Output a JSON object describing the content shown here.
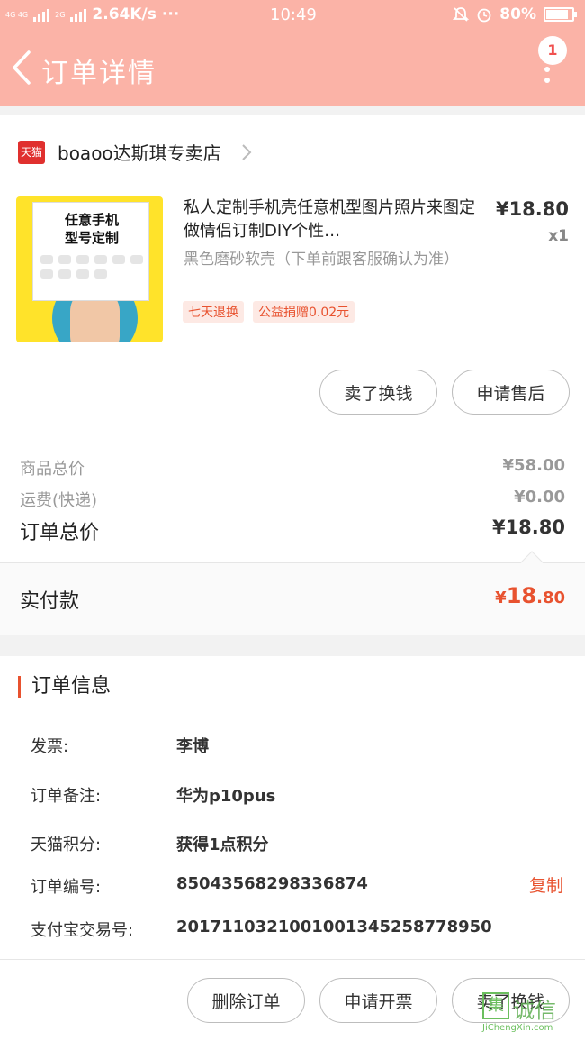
{
  "status_bar": {
    "network_top": "4G 4G",
    "network_bottom": "2G",
    "speed": "2.64K/s",
    "dots": "···",
    "time": "10:49",
    "battery": "80%"
  },
  "header": {
    "title": "订单详情",
    "badge_count": "1"
  },
  "shop": {
    "logo_text": "天猫",
    "name": "boaoo达斯琪专卖店"
  },
  "product": {
    "image_title_line1": "任意手机",
    "image_title_line2": "型号定制",
    "name": "私人定制手机壳任意机型图片照片来图定做情侣订制DIY个性…",
    "price": "¥18.80",
    "quantity": "x1",
    "spec": "黑色磨砂软壳（下单前跟客服确认为准）",
    "tags": [
      "七天退换",
      "公益捐赠0.02元"
    ]
  },
  "item_actions": {
    "sell": "卖了换钱",
    "after_sale": "申请售后"
  },
  "summary": {
    "goods_total_label": "商品总价",
    "goods_total_value": "¥58.00",
    "shipping_label": "运费(快递)",
    "shipping_value": "¥0.00",
    "order_total_label": "订单总价",
    "order_total_value": "¥18.80",
    "paid_label": "实付款",
    "paid_symbol": "¥",
    "paid_int": "18",
    "paid_dec": ".80"
  },
  "order_info": {
    "title": "订单信息",
    "rows": [
      {
        "label": "发票:",
        "value": "李博"
      },
      {
        "label": "订单备注:",
        "value": "华为p10pus"
      },
      {
        "label": "天猫积分:",
        "value": "获得1点积分"
      },
      {
        "label": "订单编号:",
        "value": "850435682983368​74"
      },
      {
        "label": "支付宝交易号:",
        "value": "2017110321001001345258778950"
      }
    ],
    "copy_label": "复制"
  },
  "bottom_actions": {
    "delete": "删除订单",
    "invoice": "申请开票",
    "sell": "卖了换钱"
  },
  "watermark": {
    "icon_text": "集",
    "cn": "诚信",
    "en": "JiChengXin.com"
  },
  "colors": {
    "header_bg": "#fbb3a7",
    "accent": "#e8522f",
    "tmall_red": "#e0302e"
  }
}
